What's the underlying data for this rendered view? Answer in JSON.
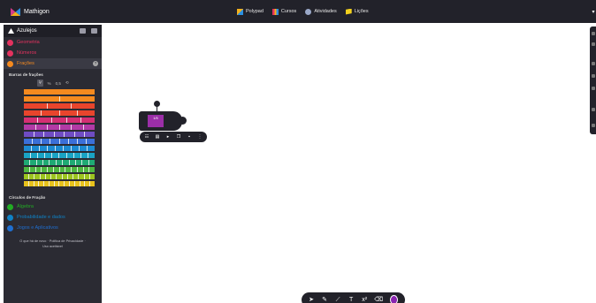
{
  "topbar": {
    "brand": "Mathigon",
    "nav": [
      "Polypad",
      "Cursos",
      "Atividades",
      "Lições"
    ]
  },
  "sidebar": {
    "title": "Azulejos",
    "categories": [
      {
        "label": "Geometria",
        "color": "#e4325f"
      },
      {
        "label": "Números",
        "color": "#e4325f"
      },
      {
        "label": "Frações",
        "color": "#f58a1f"
      }
    ],
    "bars_heading": "Barras de frações",
    "format_options": [
      "%",
      "0,5",
      "⟲"
    ],
    "circles_heading": "Círculos de Fração",
    "more_categories": [
      {
        "label": "Álgebra",
        "color": "#22ab24"
      },
      {
        "label": "Probabilidade e dados",
        "color": "#0f82c6"
      },
      {
        "label": "Jogos e Aplicativos",
        "color": "#1f6fd1"
      }
    ],
    "footer_line1": "O que há de novo · Política de Privacidade ·",
    "footer_line2": "Uso aceitável"
  },
  "fraction_bars": [
    {
      "color": "#f58a1f",
      "denominator": 1
    },
    {
      "color": "#f58a1f",
      "denominator": 2
    },
    {
      "color": "#e8452c",
      "denominator": 3
    },
    {
      "color": "#e8452c",
      "denominator": 4
    },
    {
      "color": "#d42f73",
      "denominator": 5
    },
    {
      "color": "#b23aa6",
      "denominator": 6
    },
    {
      "color": "#6f4cc3",
      "denominator": 7
    },
    {
      "color": "#3b6fd8",
      "denominator": 8
    },
    {
      "color": "#1c8ad1",
      "denominator": 9
    },
    {
      "color": "#19a3c4",
      "denominator": 10
    },
    {
      "color": "#1faa74",
      "denominator": 11
    },
    {
      "color": "#4eb640",
      "denominator": 12
    },
    {
      "color": "#9cc41f",
      "denominator": 13
    },
    {
      "color": "#e8c21c",
      "denominator": 14
    }
  ],
  "widget": {
    "fraction_text": "1/5"
  }
}
